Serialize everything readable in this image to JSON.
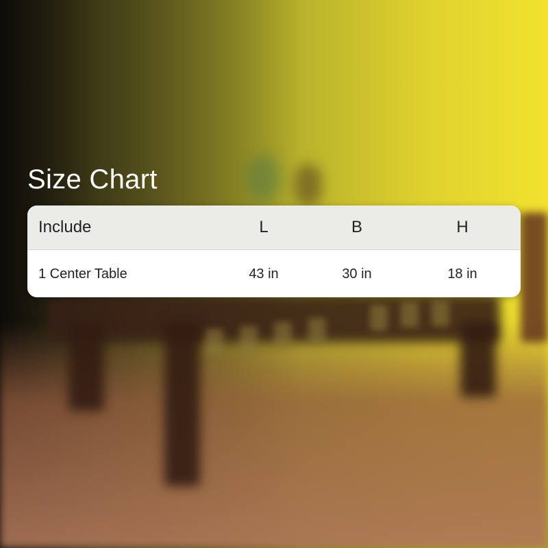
{
  "title": "Size Chart",
  "table": {
    "headers": [
      "Include",
      "L",
      "B",
      "H"
    ],
    "rows": [
      [
        "1 Center Table",
        "43 in",
        "30 in",
        "18 in"
      ]
    ]
  },
  "colors": {
    "header_bg": "#ebebe7",
    "card_bg": "#ffffff",
    "title_text": "#ffffff",
    "background_yellow": "#f1e22f"
  }
}
